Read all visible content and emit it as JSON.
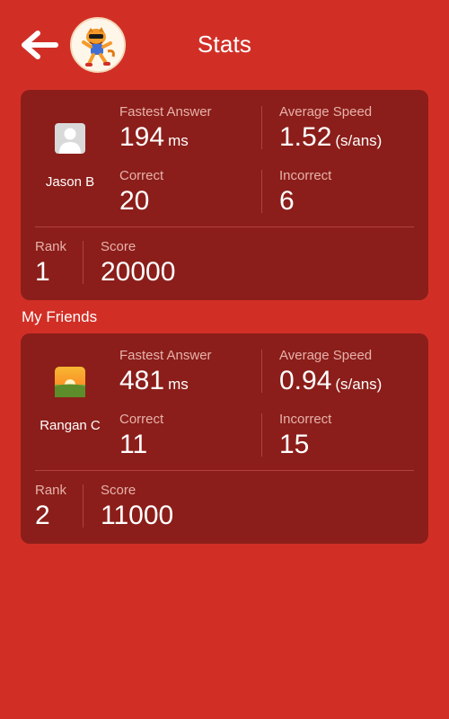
{
  "header": {
    "title": "Stats",
    "back_icon": "arrow-left-icon",
    "logo_icon": "tiger-mascot-icon"
  },
  "labels": {
    "fastest_answer": "Fastest Answer",
    "average_speed": "Average Speed",
    "correct": "Correct",
    "incorrect": "Incorrect",
    "rank": "Rank",
    "score": "Score"
  },
  "me": {
    "name": "Jason B",
    "avatar_icon": "default-user-icon",
    "fastest_answer": "194",
    "fastest_unit": "ms",
    "average_speed": "1.52",
    "average_unit": "(s/ans)",
    "correct": "20",
    "incorrect": "6",
    "rank": "1",
    "score": "20000"
  },
  "friends_section": {
    "title": "My Friends"
  },
  "friends": [
    {
      "name": "Rangan C",
      "avatar_icon": "sunset-photo-icon",
      "fastest_answer": "481",
      "fastest_unit": "ms",
      "average_speed": "0.94",
      "average_unit": "(s/ans)",
      "correct": "11",
      "incorrect": "15",
      "rank": "2",
      "score": "11000"
    }
  ],
  "colors": {
    "background": "#d12f26",
    "card": "#8b1e1a",
    "label": "#e7b1ab",
    "divider": "#b2413a"
  }
}
